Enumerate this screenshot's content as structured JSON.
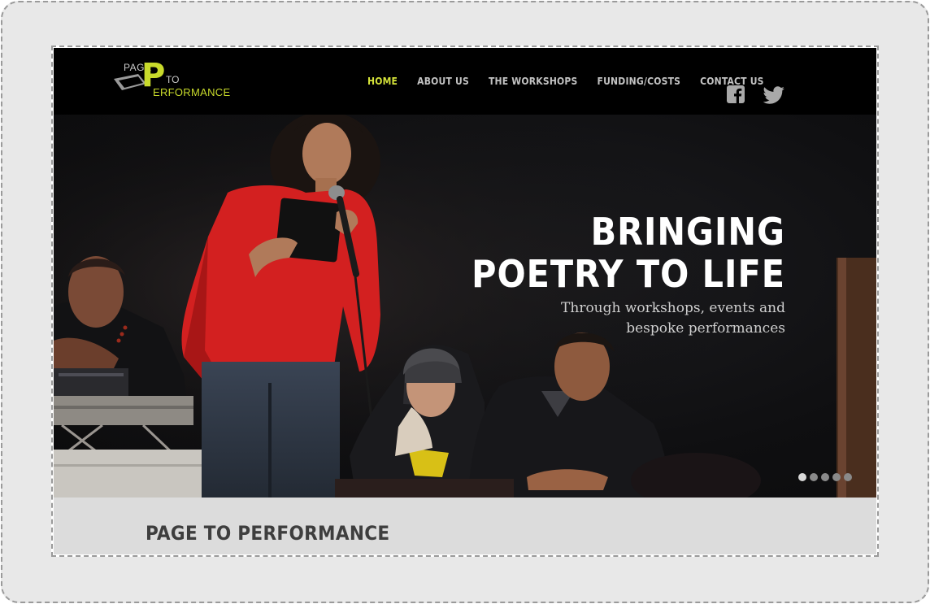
{
  "logo": {
    "page": "PAGE",
    "p": "P",
    "to": "TO",
    "performance": "ERFORMANCE"
  },
  "nav": {
    "items": [
      {
        "label": "HOME",
        "active": true
      },
      {
        "label": "ABOUT US",
        "active": false
      },
      {
        "label": "THE WORKSHOPS",
        "active": false
      },
      {
        "label": "FUNDING/COSTS",
        "active": false
      },
      {
        "label": "CONTACT US",
        "active": false
      }
    ],
    "social": [
      "facebook-icon",
      "twitter-icon"
    ]
  },
  "hero": {
    "title_line1": "BRINGING",
    "title_line2": "POETRY TO LIFE",
    "subtitle_line1": "Through workshops, events and",
    "subtitle_line2": "bespoke performances",
    "slides": 5,
    "active_slide": 1
  },
  "section": {
    "heading": "PAGE TO PERFORMANCE"
  },
  "colors": {
    "accent": "#d4e239",
    "header_bg": "#000000",
    "nav_text": "#c2c2c2",
    "section_bg": "#dcdcdc"
  }
}
